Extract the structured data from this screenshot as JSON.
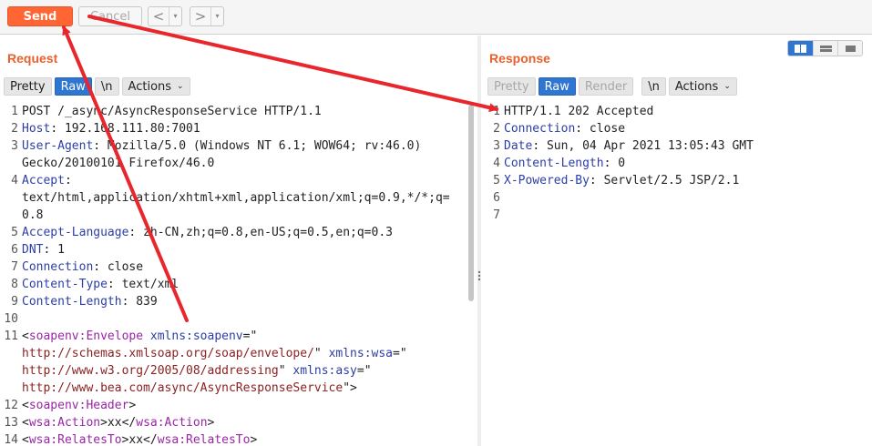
{
  "toolbar": {
    "send_label": "Send",
    "cancel_label": "Cancel",
    "back_arrow": "<",
    "forward_arrow": ">",
    "dropdown_glyph": "▾"
  },
  "request": {
    "title": "Request",
    "tabs": {
      "pretty": "Pretty",
      "raw": "Raw",
      "newline": "\\n",
      "actions": "Actions",
      "chevron": "⌄"
    },
    "lines": [
      {
        "n": "1",
        "segs": [
          {
            "c": "pl",
            "t": "POST /_async/AsyncResponseService HTTP/1.1"
          }
        ]
      },
      {
        "n": "2",
        "segs": [
          {
            "c": "hk",
            "t": "Host"
          },
          {
            "c": "pl",
            "t": ": 192.168.111.80:7001"
          }
        ]
      },
      {
        "n": "3",
        "segs": [
          {
            "c": "hk",
            "t": "User-Agent"
          },
          {
            "c": "pl",
            "t": ": Mozilla/5.0 (Windows NT 6.1; WOW64; rv:46.0)"
          }
        ]
      },
      {
        "n": "",
        "segs": [
          {
            "c": "pl",
            "t": "Gecko/20100101 Firefox/46.0"
          }
        ]
      },
      {
        "n": "4",
        "segs": [
          {
            "c": "hk",
            "t": "Accept"
          },
          {
            "c": "pl",
            "t": ":"
          }
        ]
      },
      {
        "n": "",
        "segs": [
          {
            "c": "pl",
            "t": "text/html,application/xhtml+xml,application/xml;q=0.9,*/*;q="
          }
        ]
      },
      {
        "n": "",
        "segs": [
          {
            "c": "pl",
            "t": "0.8"
          }
        ]
      },
      {
        "n": "5",
        "segs": [
          {
            "c": "hk",
            "t": "Accept-Language"
          },
          {
            "c": "pl",
            "t": ": zh-CN,zh;q=0.8,en-US;q=0.5,en;q=0.3"
          }
        ]
      },
      {
        "n": "6",
        "segs": [
          {
            "c": "hk",
            "t": "DNT"
          },
          {
            "c": "pl",
            "t": ": 1"
          }
        ]
      },
      {
        "n": "7",
        "segs": [
          {
            "c": "hk",
            "t": "Connection"
          },
          {
            "c": "pl",
            "t": ": close"
          }
        ]
      },
      {
        "n": "8",
        "segs": [
          {
            "c": "hk",
            "t": "Content-Type"
          },
          {
            "c": "pl",
            "t": ": text/xml"
          }
        ]
      },
      {
        "n": "9",
        "segs": [
          {
            "c": "hk",
            "t": "Content-Length"
          },
          {
            "c": "pl",
            "t": ": 839"
          }
        ]
      },
      {
        "n": "10",
        "segs": []
      },
      {
        "n": "11",
        "segs": [
          {
            "c": "pl",
            "t": "<"
          },
          {
            "c": "tag",
            "t": "soapenv:Envelope"
          },
          {
            "c": "pl",
            "t": " "
          },
          {
            "c": "attr",
            "t": "xmlns:soapenv"
          },
          {
            "c": "pl",
            "t": "=\""
          }
        ]
      },
      {
        "n": "",
        "segs": [
          {
            "c": "str",
            "t": "http://schemas.xmlsoap.org/soap/envelope/"
          },
          {
            "c": "pl",
            "t": "\" "
          },
          {
            "c": "attr",
            "t": "xmlns:wsa"
          },
          {
            "c": "pl",
            "t": "=\""
          }
        ]
      },
      {
        "n": "",
        "segs": [
          {
            "c": "str",
            "t": "http://www.w3.org/2005/08/addressing"
          },
          {
            "c": "pl",
            "t": "\" "
          },
          {
            "c": "attr",
            "t": "xmlns:asy"
          },
          {
            "c": "pl",
            "t": "=\""
          }
        ]
      },
      {
        "n": "",
        "segs": [
          {
            "c": "str",
            "t": "http://www.bea.com/async/AsyncResponseService"
          },
          {
            "c": "pl",
            "t": "\">"
          }
        ]
      },
      {
        "n": "12",
        "segs": [
          {
            "c": "pl",
            "t": "<"
          },
          {
            "c": "tag",
            "t": "soapenv:Header"
          },
          {
            "c": "pl",
            "t": ">"
          }
        ]
      },
      {
        "n": "13",
        "segs": [
          {
            "c": "pl",
            "t": "<"
          },
          {
            "c": "tag",
            "t": "wsa:Action"
          },
          {
            "c": "pl",
            "t": ">xx</"
          },
          {
            "c": "tag",
            "t": "wsa:Action"
          },
          {
            "c": "pl",
            "t": ">"
          }
        ]
      },
      {
        "n": "14",
        "segs": [
          {
            "c": "pl",
            "t": "<"
          },
          {
            "c": "tag",
            "t": "wsa:RelatesTo"
          },
          {
            "c": "pl",
            "t": ">xx</"
          },
          {
            "c": "tag",
            "t": "wsa:RelatesTo"
          },
          {
            "c": "pl",
            "t": ">"
          }
        ]
      }
    ]
  },
  "response": {
    "title": "Response",
    "tabs": {
      "pretty": "Pretty",
      "raw": "Raw",
      "render": "Render",
      "newline": "\\n",
      "actions": "Actions",
      "chevron": "⌄"
    },
    "lines": [
      {
        "n": "1",
        "segs": [
          {
            "c": "pl",
            "t": "HTTP/1.1 202 Accepted"
          }
        ]
      },
      {
        "n": "2",
        "segs": [
          {
            "c": "hk",
            "t": "Connection"
          },
          {
            "c": "pl",
            "t": ": close"
          }
        ]
      },
      {
        "n": "3",
        "segs": [
          {
            "c": "hk",
            "t": "Date"
          },
          {
            "c": "pl",
            "t": ": Sun, 04 Apr 2021 13:05:43 GMT"
          }
        ]
      },
      {
        "n": "4",
        "segs": [
          {
            "c": "hk",
            "t": "Content-Length"
          },
          {
            "c": "pl",
            "t": ": 0"
          }
        ]
      },
      {
        "n": "5",
        "segs": [
          {
            "c": "hk",
            "t": "X-Powered-By"
          },
          {
            "c": "pl",
            "t": ": Servlet/2.5 JSP/2.1"
          }
        ]
      },
      {
        "n": "6",
        "segs": []
      },
      {
        "n": "7",
        "segs": []
      }
    ]
  },
  "colors": {
    "accent": "#ff6633",
    "title": "#e8602c",
    "active_tab": "#2f76d2",
    "annotation": "#e8262c"
  }
}
